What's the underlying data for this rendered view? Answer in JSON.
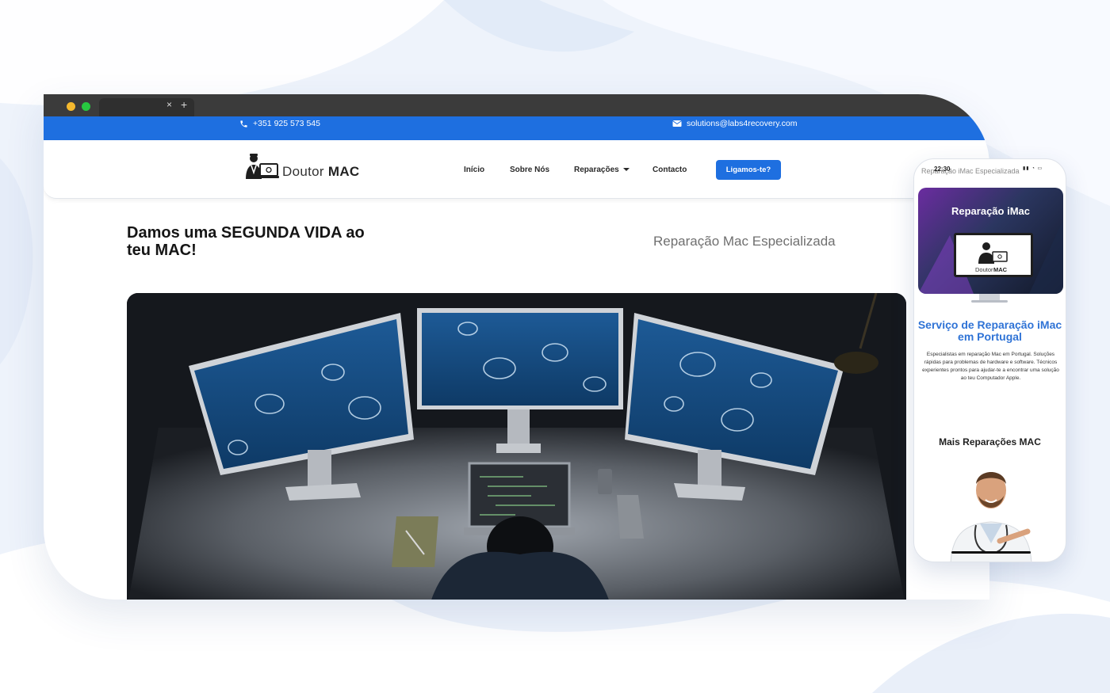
{
  "colors": {
    "brand_blue": "#1e6fe0",
    "heading_blue": "#2f73d6",
    "page_background": "#eef3fb",
    "browser_chrome": "#3b3b3b"
  },
  "browser": {
    "tab_close": "×",
    "tab_add": "+"
  },
  "topbar": {
    "phone_icon": "phone-icon",
    "phone": "+351 925 573 545",
    "mail_icon": "envelope-icon",
    "email": "solutions@labs4recovery.com"
  },
  "header": {
    "logo_word1": "Doutor",
    "logo_word2": "MAC",
    "nav": [
      "Início",
      "Sobre Nós",
      "Reparações",
      "Contacto"
    ],
    "cta": "Ligamos-te?"
  },
  "hero": {
    "title": "Damos uma SEGUNDA VIDA ao teu MAC!",
    "subtitle": "Reparação Mac Especializada"
  },
  "phone_view": {
    "time": "22:30",
    "page_title": "Reparação iMac Especializada",
    "hero_title": "Reparação iMac",
    "logo_word1": "Doutor",
    "logo_word2": "MAC",
    "heading": "Serviço de Reparação iMac em Portugal",
    "body": "Especialistas em reparação Mac em Portugal. Soluções rápidas para problemas de hardware e software. Técnicos experientes prontos para ajudar-te a encontrar uma solução ao teu Computador Apple.",
    "section_title": "Mais Reparações MAC"
  }
}
